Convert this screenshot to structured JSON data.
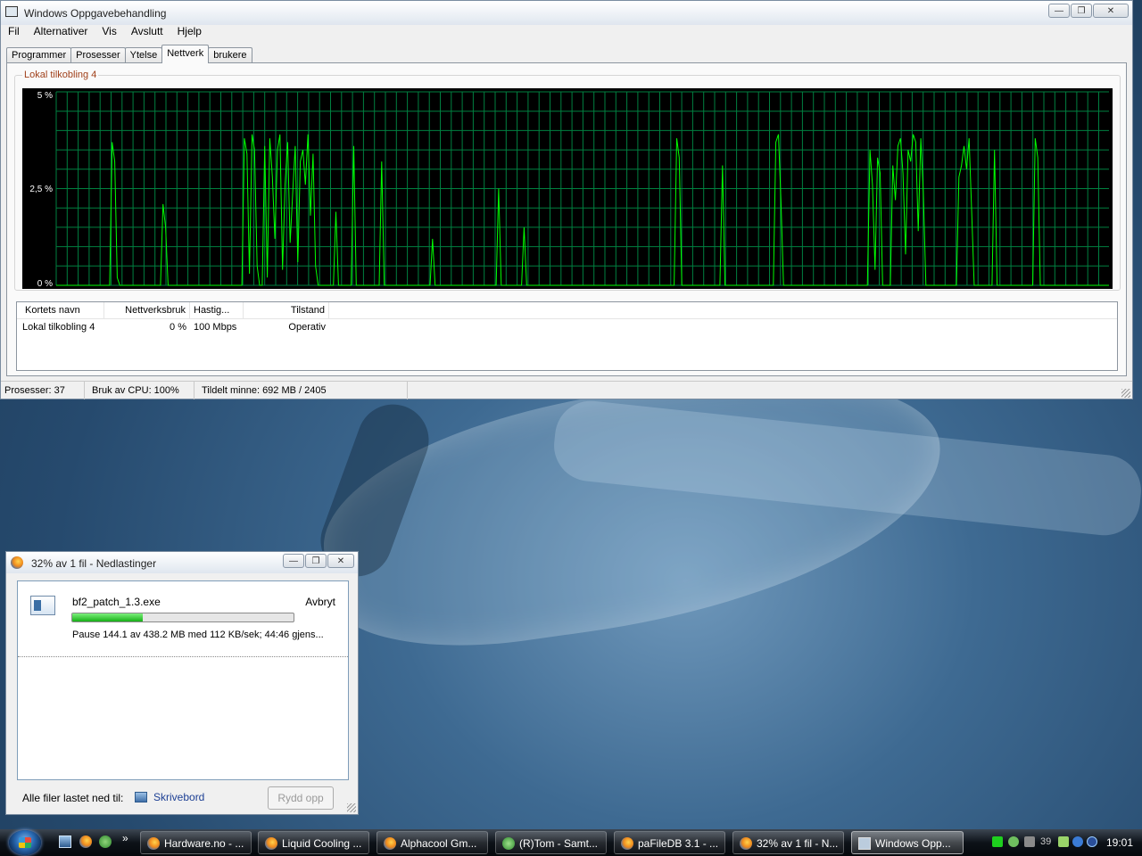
{
  "task_manager": {
    "title": "Windows Oppgavebehandling",
    "menu": [
      "Fil",
      "Alternativer",
      "Vis",
      "Avslutt",
      "Hjelp"
    ],
    "tabs": [
      "Programmer",
      "Prosesser",
      "Ytelse",
      "Nettverk",
      "brukere"
    ],
    "active_tab": "Nettverk",
    "graph_title": "Lokal tilkobling 4",
    "y_ticks": [
      "5 %",
      "2,5 %",
      "0 %"
    ],
    "graph_colors": {
      "background": "#000000",
      "grid": "#008040",
      "line": "#00ff00"
    },
    "table": {
      "headers": [
        "Kortets navn",
        "Nettverksbruk",
        "Hastig...",
        "Tilstand"
      ],
      "rows": [
        [
          "Lokal tilkobling 4",
          "0 %",
          "100 Mbps",
          "Operativ"
        ]
      ]
    },
    "status": {
      "processes": "Prosesser: 37",
      "cpu": "Bruk av CPU: 100%",
      "memory": "Tildelt minne: 692 MB / 2405"
    }
  },
  "chart_data": {
    "type": "line",
    "title": "Lokal tilkobling 4",
    "ylim": [
      0,
      5
    ],
    "y_tick_labels": [
      "0 %",
      "2,5 %",
      "5 %"
    ],
    "grid": true,
    "series": [
      {
        "values": [
          0,
          0,
          0,
          0,
          0,
          0,
          0,
          0,
          0,
          0,
          0,
          0,
          0,
          0,
          0,
          0,
          0,
          0,
          0,
          0,
          0,
          0,
          3.7,
          3.2,
          0.2,
          0,
          0,
          0,
          0,
          0,
          0,
          0,
          0,
          0,
          0,
          0,
          0,
          0,
          0,
          0,
          0,
          0,
          2.1,
          1.5,
          0,
          0,
          0,
          0,
          0,
          0,
          0,
          0,
          0,
          0,
          0,
          0,
          0,
          0,
          0,
          0,
          0,
          0,
          0,
          0,
          0,
          0,
          0,
          0,
          0,
          0,
          0,
          0,
          0,
          0,
          3.8,
          3.4,
          0.3,
          3.9,
          3.5,
          0.5,
          0,
          0,
          3.6,
          0.2,
          3.8,
          2.8,
          1.2,
          3.5,
          3.9,
          0.4,
          2.6,
          3.7,
          1.1,
          2.4,
          3.6,
          0.6,
          3.2,
          3.5,
          2.6,
          3.9,
          1.8,
          3.4,
          0.5,
          0,
          0,
          0,
          0,
          0,
          0,
          0,
          1.9,
          0,
          0,
          0,
          0,
          0,
          0,
          3.6,
          0,
          0,
          0,
          0,
          0,
          0,
          0,
          0,
          0,
          0,
          3.2,
          0,
          0,
          0,
          0,
          0,
          0,
          0,
          0,
          0,
          0,
          0,
          0,
          0,
          0,
          0,
          0,
          0,
          0,
          0,
          1.2,
          0,
          0,
          0,
          0,
          0,
          0,
          0,
          0,
          0,
          0,
          0,
          0,
          0,
          0,
          0,
          0,
          0,
          0,
          0,
          0,
          0,
          0,
          0,
          0,
          0,
          2.5,
          0,
          0,
          0,
          0,
          0,
          0,
          0,
          0,
          0,
          1.5,
          0,
          0,
          0,
          0,
          0,
          0,
          0,
          0,
          0,
          0,
          0,
          0,
          0,
          0,
          0,
          0,
          0,
          0,
          0,
          0,
          0,
          0,
          0,
          0,
          0,
          0,
          0,
          0,
          0,
          0,
          0,
          0,
          0,
          0,
          0,
          0,
          0,
          0,
          0,
          0,
          0,
          0,
          0,
          0,
          0,
          0,
          0,
          0,
          0,
          0,
          0,
          0,
          0,
          0,
          0,
          0,
          0,
          0,
          0,
          3.8,
          3.3,
          0,
          0,
          0,
          0,
          0,
          0,
          0,
          0,
          0,
          0,
          0,
          0,
          0,
          0,
          0,
          0,
          3.1,
          0,
          0,
          0,
          0,
          0,
          0,
          0,
          0,
          0,
          0,
          0,
          0,
          0,
          0,
          0,
          0,
          0,
          0,
          0,
          0,
          3.7,
          3.9,
          2.2,
          0,
          0,
          0,
          0,
          0,
          0,
          0,
          0,
          0,
          0,
          0,
          0,
          0,
          0,
          0,
          0,
          0,
          0,
          0,
          0,
          0,
          0,
          0,
          0,
          0,
          0,
          0,
          0,
          0,
          0,
          0,
          0,
          0,
          0,
          3.5,
          2.6,
          0.4,
          3.3,
          2.9,
          0,
          0,
          0,
          0,
          3.1,
          2.2,
          3.6,
          3.8,
          2.9,
          0.8,
          3.5,
          3.2,
          3.9,
          3.7,
          1.4,
          3.8,
          2.4,
          0,
          0,
          0,
          0,
          0,
          0,
          0,
          0,
          0,
          0,
          0,
          0,
          0,
          2.8,
          3.1,
          3.6,
          3.0,
          3.8,
          1.9,
          0,
          0,
          0,
          0,
          0,
          0,
          0,
          0,
          3.5,
          0,
          0,
          0,
          0,
          0,
          0,
          0,
          0,
          0,
          0,
          0,
          0,
          0,
          0,
          0,
          3.8,
          3.3,
          0,
          0,
          0,
          0,
          0,
          0,
          0,
          0,
          0,
          0,
          0,
          0,
          0,
          0,
          0,
          0,
          0,
          0,
          0,
          0,
          0,
          0,
          0,
          0,
          0,
          0,
          0,
          0
        ]
      }
    ]
  },
  "download_window": {
    "title": "32% av 1 fil - Nedlastinger",
    "file_name": "bf2_patch_1.3.exe",
    "cancel_label": "Avbryt",
    "progress": 0.32,
    "status_text": "Pause    144.1 av 438.2 MB med 112 KB/sek; 44:46 gjens...",
    "footer_label": "Alle filer lastet ned til:",
    "folder_name": "Skrivebord",
    "clear_button": "Rydd opp"
  },
  "taskbar": {
    "buttons": [
      {
        "label": "Hardware.no - ...",
        "icon": "firefox-icon"
      },
      {
        "label": "Liquid Cooling ...",
        "icon": "firefox-icon"
      },
      {
        "label": "Alphacool Gm...",
        "icon": "firefox-icon"
      },
      {
        "label": "(R)Tom - Samt...",
        "icon": "messenger-icon"
      },
      {
        "label": "paFileDB 3.1 - ...",
        "icon": "firefox-icon"
      },
      {
        "label": "32% av 1 fil - N...",
        "icon": "firefox-icon"
      },
      {
        "label": "Windows Opp...",
        "icon": "taskmanager-icon"
      }
    ],
    "tray_number": "39",
    "clock": "19:01"
  }
}
